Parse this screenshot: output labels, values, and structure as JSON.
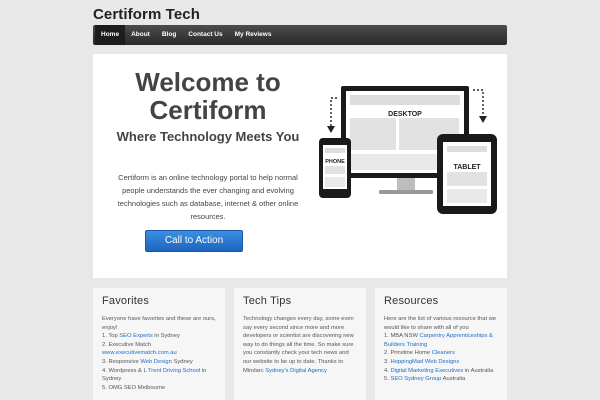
{
  "site": {
    "title": "Certiform Tech"
  },
  "nav": {
    "items": [
      "Home",
      "About",
      "Blog",
      "Contact Us",
      "My Reviews"
    ]
  },
  "hero": {
    "title_line1": "Welcome to",
    "title_line2": "Certiform",
    "subtitle": "Where Technology Meets You",
    "description": "Certiform is an online technology portal to help normal people understands the ever changing and evolving technologies such as database, internet & other online resources.",
    "cta_label": "Call to Action",
    "devices": {
      "desktop": "DESKTOP",
      "tablet": "TABLET",
      "phone": "PHONE"
    }
  },
  "favorites": {
    "title": "Favorites",
    "intro": "Everyone have favorites and these are ours, enjoy!",
    "items": [
      {
        "pre": "1. Top ",
        "link": "SEO Experts",
        "post": " in Sydney"
      },
      {
        "pre": "2. Executive Match ",
        "link": "www.executivematch.com.au",
        "post": ""
      },
      {
        "pre": "3. Responsive ",
        "link": "Web Design",
        "post": " Sydney"
      },
      {
        "pre": "4. Wordpress & L ",
        "link": "Trent Driving School",
        "post": " in Sydney"
      },
      {
        "pre": "5. OMG SEO Melbourne",
        "link": "",
        "post": ""
      }
    ]
  },
  "tech_tips": {
    "title": "Tech Tips",
    "text": "Technology changes every day, some even say every second since more and more developers or scientist are discovering new way to do things all the time. So make sure you constantly check your tech news and our website to be up to date. Thanks to Mindarc ",
    "link": "Sydney's Digital Agency"
  },
  "resources": {
    "title": "Resources",
    "intro": "Here are the list of various resource that we would like to share with all of you",
    "items": [
      {
        "pre": "1. MBA NSW ",
        "link": "Carpentry Apprenticeships & Builders Training",
        "post": ""
      },
      {
        "pre": "2. Prinstine Home ",
        "link": "Cleaners",
        "post": ""
      },
      {
        "pre": "3. ",
        "link": "HoppingMad Web Designs",
        "post": ""
      },
      {
        "pre": "4. ",
        "link": "Digital Marketing Executives",
        "post": " in Australia"
      },
      {
        "pre": "5. ",
        "link": "SEO Sydney Group",
        "post": " Australia"
      }
    ]
  }
}
